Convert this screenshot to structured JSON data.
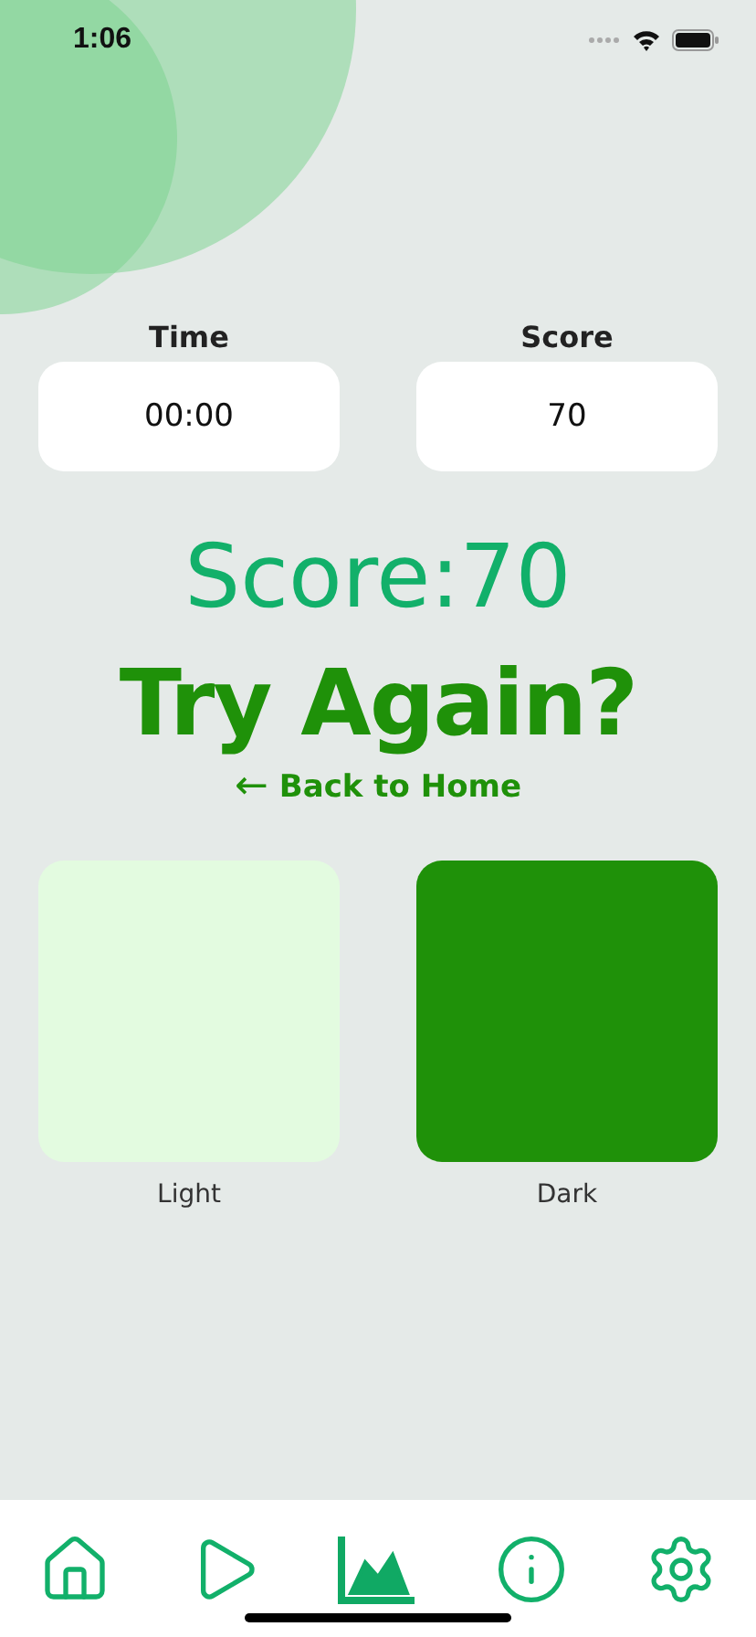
{
  "status_bar": {
    "time": "1:06"
  },
  "stats": [
    {
      "label": "Time",
      "value": "00:00"
    },
    {
      "label": "Score",
      "value": "70"
    }
  ],
  "score_text": "Score:70",
  "headline": "Try Again?",
  "back_link": {
    "arrow": "←",
    "label": "Back to Home"
  },
  "themes": [
    {
      "label": "Light",
      "color": "#e3fbe0"
    },
    {
      "label": "Dark",
      "color": "#1f9109"
    }
  ],
  "tab_bar": [
    {
      "kind": "home",
      "selected": false
    },
    {
      "kind": "play",
      "selected": false
    },
    {
      "kind": "chart",
      "selected": true
    },
    {
      "kind": "info",
      "selected": false
    },
    {
      "kind": "settings",
      "selected": false
    }
  ]
}
